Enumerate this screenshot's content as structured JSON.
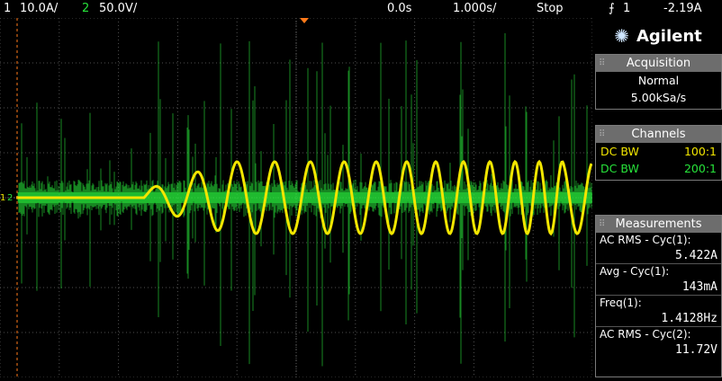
{
  "topbar": {
    "ch1_num": "1",
    "ch1_scale": "10.0A/",
    "ch2_num": "2",
    "ch2_scale": "50.0V/",
    "time_delay": "0.0s",
    "time_scale": "1.000s/",
    "run_state": "Stop",
    "trigger_icon": "rising-edge-icon",
    "trigger_channel": "1",
    "trigger_level": "-2.19A"
  },
  "brand": {
    "name": "Agilent",
    "icon": "agilent-spark-icon"
  },
  "acquisition": {
    "title": "Acquisition",
    "mode": "Normal",
    "rate": "5.00kSa/s"
  },
  "channels": {
    "title": "Channels",
    "items": [
      {
        "coupling": "DC BW",
        "probe": "100:1",
        "color": "#f2e600"
      },
      {
        "coupling": "DC BW",
        "probe": "200:1",
        "color": "#27e33a"
      }
    ]
  },
  "measurements": {
    "title": "Measurements",
    "items": [
      {
        "label": "AC RMS - Cyc(1):",
        "value": "5.422A"
      },
      {
        "label": "Avg - Cyc(1):",
        "value": "143mA"
      },
      {
        "label": "Freq(1):",
        "value": "1.4128Hz"
      },
      {
        "label": "AC RMS - Cyc(2):",
        "value": "11.72V"
      }
    ]
  },
  "markers": {
    "ch1_ground": "1",
    "ch2_ground": "2"
  },
  "colors": {
    "ch1": "#f2e600",
    "ch2": "#27e33a",
    "grid": "#5a5a5a",
    "trigger_marker": "#ff7a1a"
  }
}
